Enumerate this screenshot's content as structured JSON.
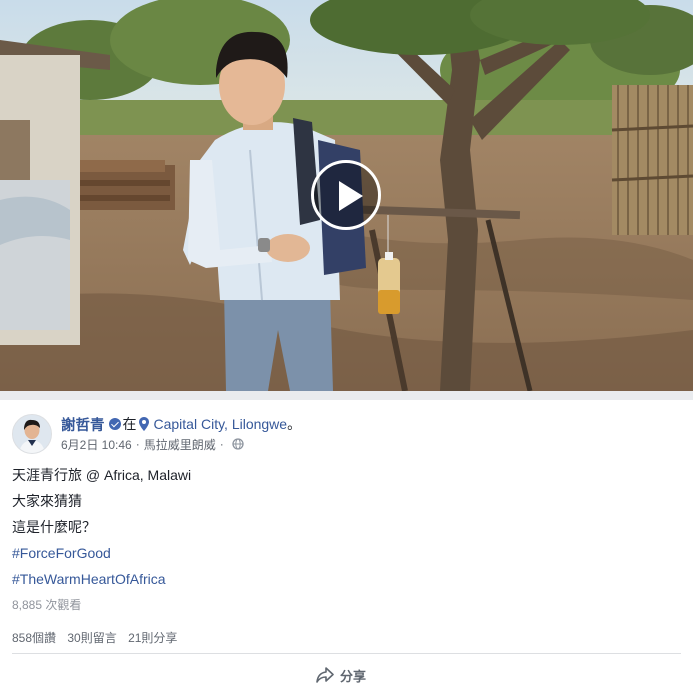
{
  "video": {
    "play_button": "play-icon"
  },
  "post": {
    "author": "謝哲青",
    "verified_icon": "verified-badge-icon",
    "at_word": "在",
    "location_icon": "map-pin-icon",
    "location": "Capital City, Lilongwe",
    "period": "。",
    "date": "6月2日 10:46",
    "place": "馬拉威里朗威",
    "separator": "·",
    "privacy_icon": "globe-icon",
    "lines": [
      "天涯青行旅 @ Africa, Malawi",
      "大家來猜猜",
      "這是什麼呢？"
    ],
    "hashtags": [
      "#ForceForGood",
      "#TheWarmHeartOfAfrica"
    ],
    "views": "8,885 次觀看",
    "likes": "858個讚",
    "comments": "30則留言",
    "shares": "21則分享",
    "share_label": "分享"
  },
  "colors": {
    "link": "#365899",
    "text": "#1d2129",
    "meta": "#616770",
    "badge": "#4267b2"
  }
}
